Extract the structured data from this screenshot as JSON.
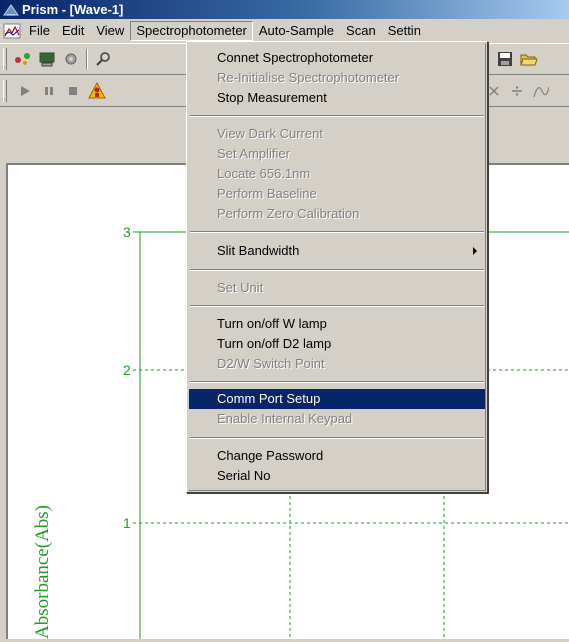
{
  "window": {
    "title": "Prism - [Wave-1]"
  },
  "menubar": {
    "items": [
      "File",
      "Edit",
      "View",
      "Spectrophotometer",
      "Auto-Sample",
      "Scan",
      "Settin"
    ]
  },
  "dropdown": {
    "items": [
      {
        "label": "Connet Spectrophotometer",
        "enabled": true
      },
      {
        "label": "Re-Initialise Spectrophotometer",
        "enabled": false
      },
      {
        "label": "Stop Measurement",
        "enabled": true
      },
      {
        "label": "View Dark Current",
        "enabled": false
      },
      {
        "label": "Set Amplifier",
        "enabled": false
      },
      {
        "label": "Locate 656.1nm",
        "enabled": false
      },
      {
        "label": "Perform Baseline",
        "enabled": false
      },
      {
        "label": "Perform Zero Calibration",
        "enabled": false
      },
      {
        "label": "Slit Bandwidth",
        "enabled": true,
        "submenu": true
      },
      {
        "label": "Set Unit",
        "enabled": false
      },
      {
        "label": "Turn on/off W lamp",
        "enabled": true
      },
      {
        "label": "Turn on/off D2 lamp",
        "enabled": true
      },
      {
        "label": "D2/W Switch Point",
        "enabled": false
      },
      {
        "label": "Comm Port Setup",
        "enabled": true,
        "highlighted": true
      },
      {
        "label": "Enable Internal Keypad",
        "enabled": false
      },
      {
        "label": "Change Password",
        "enabled": true
      },
      {
        "label": "Serial No",
        "enabled": true
      }
    ]
  },
  "plot": {
    "ylabel": "Absorbance(Abs)",
    "yticks": [
      "3",
      "2",
      "1"
    ],
    "color": "#1e9e1e"
  },
  "colors": {
    "title_start": "#0a246a",
    "highlight": "#0a246a",
    "menu_bg": "#d4d0c8"
  }
}
